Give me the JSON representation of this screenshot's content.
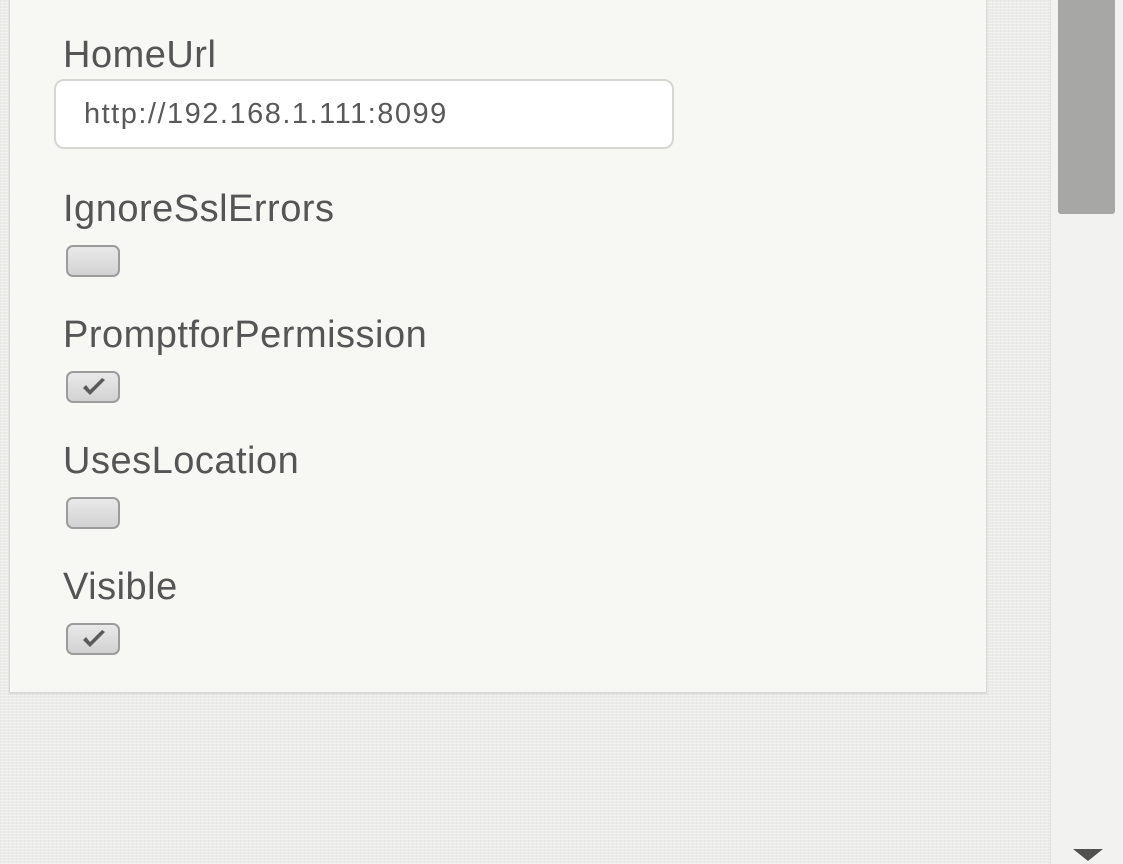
{
  "properties": {
    "home_url": {
      "label": "HomeUrl",
      "value": "http://192.168.1.111:8099"
    },
    "ignore_ssl_errors": {
      "label": "IgnoreSslErrors",
      "checked": false
    },
    "prompt_for_permission": {
      "label": "PromptforPermission",
      "checked": true
    },
    "uses_location": {
      "label": "UsesLocation",
      "checked": false
    },
    "visible": {
      "label": "Visible",
      "checked": true
    }
  },
  "icons": {
    "checkmark": "checkmark-icon",
    "scroll_down": "scroll-down-arrow-icon"
  },
  "colors": {
    "panel_bg": "#f7f7f4",
    "label_text": "#555555",
    "checkmark": "#5a5a5a",
    "scroll_thumb": "#a7a7a6"
  }
}
